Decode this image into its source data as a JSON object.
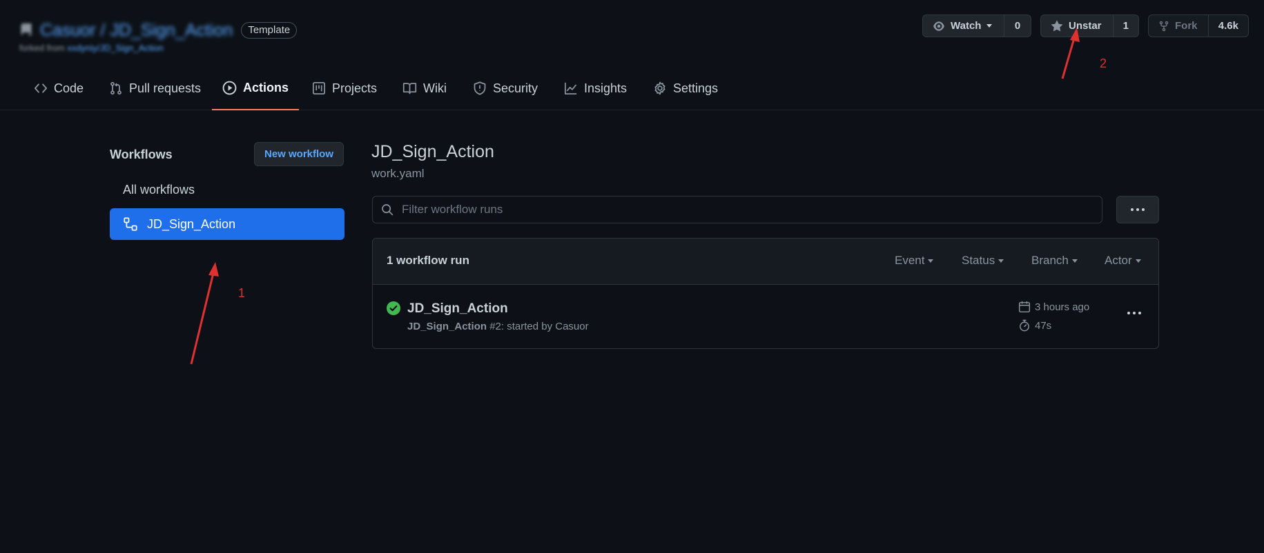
{
  "repo": {
    "owner": "Casuor",
    "name": "JD_Sign_Action",
    "separator": "/",
    "badge": "Template",
    "forked_prefix": "forked from",
    "forked_source": "xxdyniy/JD_Sign_Action"
  },
  "actions": {
    "watch": {
      "label": "Watch",
      "count": "0",
      "icon": "eye-icon"
    },
    "star": {
      "label": "Unstar",
      "count": "1",
      "icon": "star-icon"
    },
    "fork": {
      "label": "Fork",
      "count": "4.6k",
      "icon": "fork-icon"
    }
  },
  "tabs": [
    {
      "label": "Code",
      "icon": "code-icon"
    },
    {
      "label": "Pull requests",
      "icon": "pull-request-icon"
    },
    {
      "label": "Actions",
      "icon": "play-icon",
      "active": true
    },
    {
      "label": "Projects",
      "icon": "project-icon"
    },
    {
      "label": "Wiki",
      "icon": "book-icon"
    },
    {
      "label": "Security",
      "icon": "shield-icon"
    },
    {
      "label": "Insights",
      "icon": "graph-icon"
    },
    {
      "label": "Settings",
      "icon": "gear-icon"
    }
  ],
  "sidebar": {
    "title": "Workflows",
    "new_workflow": "New workflow",
    "all_workflows": "All workflows",
    "items": [
      {
        "label": "JD_Sign_Action",
        "icon": "workflow-icon",
        "selected": true
      }
    ]
  },
  "main": {
    "title": "JD_Sign_Action",
    "file": "work.yaml",
    "filter_placeholder": "Filter workflow runs",
    "run_count": "1 workflow run",
    "filters": [
      "Event",
      "Status",
      "Branch",
      "Actor"
    ],
    "runs": [
      {
        "title": "JD_Sign_Action",
        "workflow": "JD_Sign_Action",
        "detail": "#2: started by Casuor",
        "time": "3 hours ago",
        "duration": "47s",
        "status": "success"
      }
    ]
  },
  "annotations": {
    "one": "1",
    "two": "2"
  },
  "colors": {
    "background": "#0d1117",
    "accent": "#1f6feb",
    "link": "#58a6ff",
    "success": "#3fb950",
    "active_tab": "#f78166",
    "annotation": "#e03131"
  }
}
